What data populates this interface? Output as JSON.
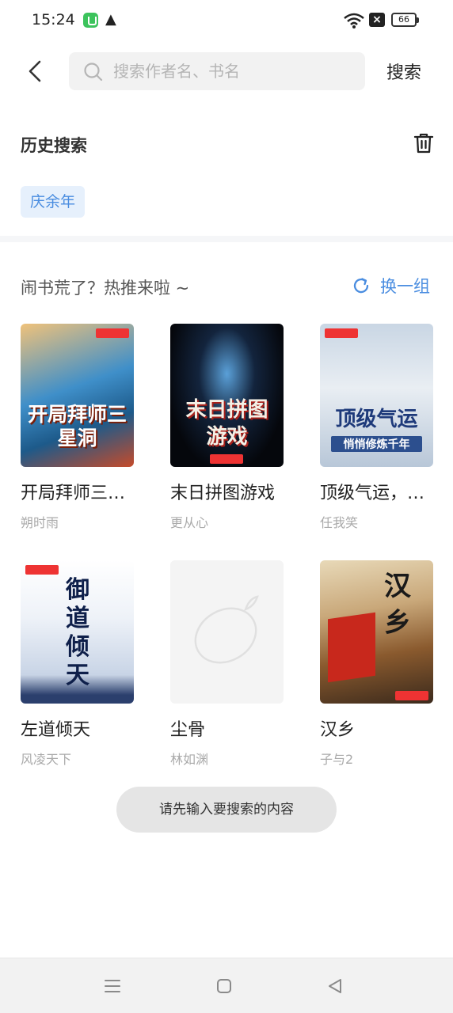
{
  "status": {
    "time": "15:24",
    "battery": "66"
  },
  "search": {
    "placeholder": "搜索作者名、书名",
    "value": "",
    "submit_label": "搜索"
  },
  "history": {
    "title": "历史搜索",
    "tags": [
      "庆余年"
    ]
  },
  "recommend": {
    "title": "闹书荒了？热推来啦 ~",
    "refresh_label": "换一组",
    "books": [
      {
        "title": "开局拜师三…",
        "author": "朔时雨",
        "cover_text": "开局拜师三星洞"
      },
      {
        "title": "末日拼图游戏",
        "author": "更从心",
        "cover_text": "末日拼图游戏"
      },
      {
        "title": "顶级气运，…",
        "author": "任我笑",
        "cover_text": "顶级气运",
        "cover_sub": "悄悄修炼千年"
      },
      {
        "title": "左道倾天",
        "author": "风凌天下",
        "cover_text": "御道倾天"
      },
      {
        "title": "尘骨",
        "author": "林如渊",
        "cover_text": ""
      },
      {
        "title": "汉乡",
        "author": "子与2",
        "cover_text": "汉乡"
      }
    ]
  },
  "toast": "请先输入要搜索的内容",
  "colors": {
    "accent": "#4a8de0",
    "tag_bg": "#e6f0fc",
    "toast_bg": "#e5e5e5"
  },
  "icons": [
    "back-icon",
    "search-icon",
    "trash-icon",
    "refresh-icon",
    "lemon-placeholder-icon",
    "menu-icon",
    "home-icon",
    "back-triangle-icon"
  ]
}
